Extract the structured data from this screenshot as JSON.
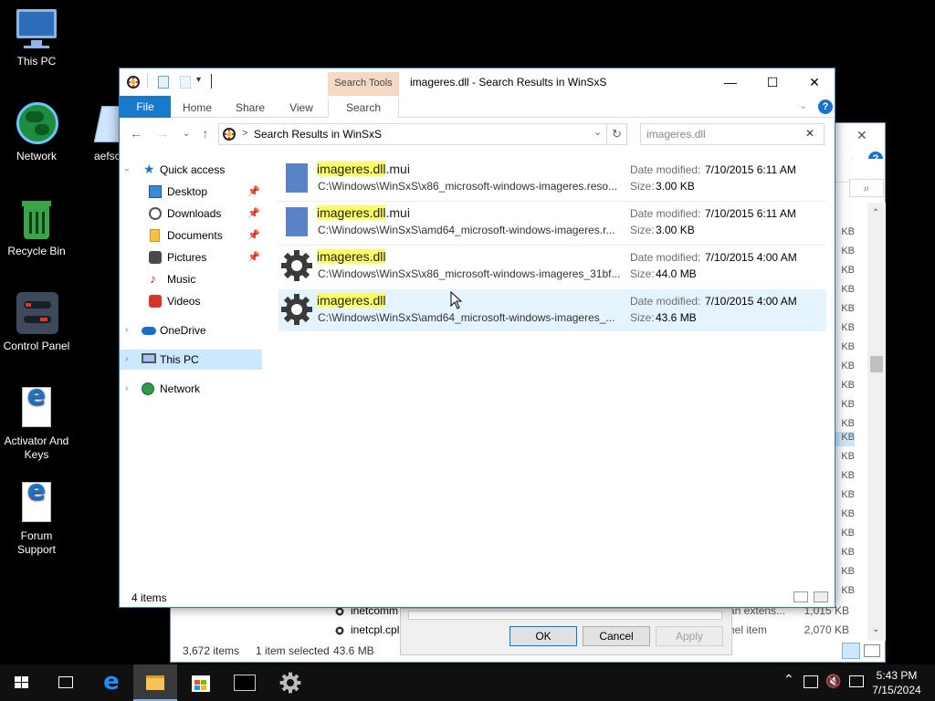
{
  "desktop": {
    "icons": [
      {
        "label": "This PC"
      },
      {
        "label": "Network"
      },
      {
        "label": "aefsc"
      },
      {
        "label": "Recycle Bin"
      },
      {
        "label": "Control Panel"
      },
      {
        "label": "Activator And Keys"
      },
      {
        "label": "Forum Support"
      }
    ]
  },
  "background_window": {
    "status_items": "3,672 items",
    "status_selected": "1 item selected",
    "status_size": "43.6 MB",
    "kb_label": "KB",
    "rows": [
      {
        "name": "inetcomm",
        "type": "an extens...",
        "size": "1,015 KB"
      },
      {
        "name": "inetcpl.cpl",
        "type": "nel item",
        "size": "2,070 KB"
      }
    ],
    "dialog_buttons": {
      "ok": "OK",
      "cancel": "Cancel",
      "apply": "Apply"
    }
  },
  "window": {
    "title": "imageres.dll - Search Results in WinSxS",
    "controls": {
      "minimize": "—",
      "maximize": "☐",
      "close": "✕"
    },
    "ribbon": {
      "contextual_label": "Search Tools",
      "tabs": [
        "File",
        "Home",
        "Share",
        "View",
        "Search"
      ]
    },
    "address": {
      "path": "Search Results in WinSxS",
      "separator": ">"
    },
    "search": {
      "value": "imageres.dll"
    },
    "nav": {
      "quick_access": "Quick access",
      "items": [
        {
          "label": "Desktop",
          "pinned": true
        },
        {
          "label": "Downloads",
          "pinned": true
        },
        {
          "label": "Documents",
          "pinned": true
        },
        {
          "label": "Pictures",
          "pinned": true
        },
        {
          "label": "Music",
          "pinned": false
        },
        {
          "label": "Videos",
          "pinned": false
        }
      ],
      "onedrive": "OneDrive",
      "this_pc": "This PC",
      "network": "Network"
    },
    "results": [
      {
        "name_hl": "imageres.dll",
        "name_rest": ".mui",
        "path": "C:\\Windows\\WinSxS\\x86_microsoft-windows-imageres.reso...",
        "date_label": "Date modified:",
        "date": "7/10/2015 6:11 AM",
        "size_label": "Size:",
        "size": "3.00 KB",
        "icon": "document-icon"
      },
      {
        "name_hl": "imageres.dll",
        "name_rest": ".mui",
        "path": "C:\\Windows\\WinSxS\\amd64_microsoft-windows-imageres.r...",
        "date_label": "Date modified:",
        "date": "7/10/2015 6:11 AM",
        "size_label": "Size:",
        "size": "3.00 KB",
        "icon": "document-icon"
      },
      {
        "name_hl": "imageres.dll",
        "name_rest": "",
        "path": "C:\\Windows\\WinSxS\\x86_microsoft-windows-imageres_31bf...",
        "date_label": "Date modified:",
        "date": "7/10/2015 4:00 AM",
        "size_label": "Size:",
        "size": "44.0 MB",
        "icon": "gear-icon"
      },
      {
        "name_hl": "imageres.dll",
        "name_rest": "",
        "path": "C:\\Windows\\WinSxS\\amd64_microsoft-windows-imageres_...",
        "date_label": "Date modified:",
        "date": "7/10/2015 4:00 AM",
        "size_label": "Size:",
        "size": "43.6 MB",
        "icon": "gear-icon",
        "selected": true
      }
    ],
    "status": "4 items"
  },
  "taskbar": {
    "time": "5:43 PM",
    "date": "7/15/2024"
  },
  "colors": {
    "accent": "#2b78d0",
    "file_tab": "#1979ca",
    "search_tools": "#f6d9c3",
    "highlight": "#ffff66",
    "selected_row": "#e5f3ff",
    "taskbar": "#101010"
  }
}
